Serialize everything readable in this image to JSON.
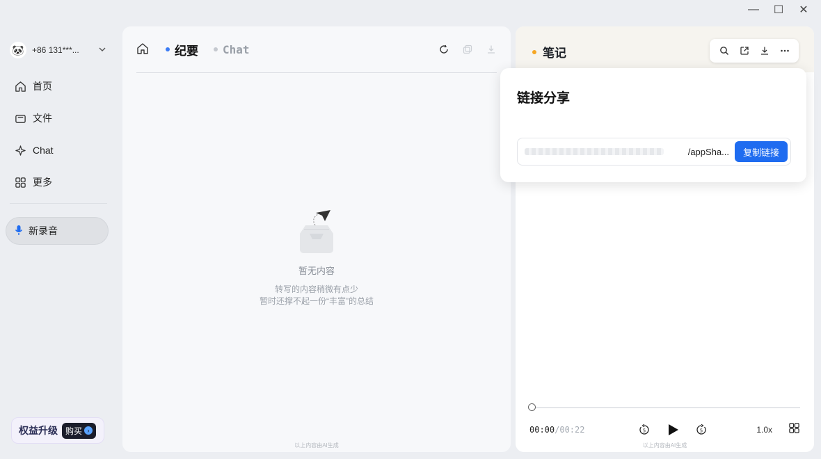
{
  "window": {
    "minimize": "—",
    "maximize": "☐",
    "close": "✕"
  },
  "account": {
    "phone": "+86 131***...",
    "avatar": "🐼"
  },
  "sidebar": {
    "items": [
      {
        "label": "首页",
        "icon": "home-icon"
      },
      {
        "label": "文件",
        "icon": "folder-icon"
      },
      {
        "label": "Chat",
        "icon": "sparkle-icon"
      },
      {
        "label": "更多",
        "icon": "apps-icon"
      }
    ],
    "new_recording": "新录音",
    "upgrade_label": "权益升级",
    "buy_label": "购买"
  },
  "main": {
    "tabs": [
      {
        "label": "纪要",
        "active": true,
        "dot_color": "#3b7cf5"
      },
      {
        "label": "Chat",
        "active": false,
        "dot_color": "#c5c9cf"
      }
    ],
    "empty_title": "暂无内容",
    "empty_line1": "转写的内容稍微有点少",
    "empty_line2": "暂时还撑不起一份“丰富”的总结",
    "foot_note": "以上内容由AI生成"
  },
  "notes": {
    "title": "笔记",
    "dot_color": "#f5a623",
    "player": {
      "current": "00:00",
      "total": "/00:22",
      "progress": 0,
      "speed": "1.0x"
    },
    "foot_note": "以上内容由AI生成"
  },
  "share": {
    "title": "链接分享",
    "url_tail": "/appSha...",
    "copy_label": "复制链接"
  },
  "colors": {
    "accent": "#1f6cf0"
  }
}
